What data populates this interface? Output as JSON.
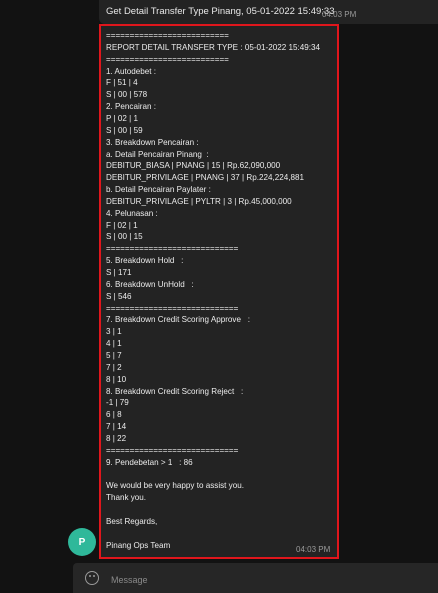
{
  "header_message": {
    "text": "Get Detail Transfer Type Pinang, 05-01-2022 15:49:33",
    "time": "04:03 PM"
  },
  "message": {
    "lines": [
      "==========================",
      "REPORT DETAIL TRANSFER TYPE : 05-01-2022 15:49:34",
      "==========================",
      "1. Autodebet :",
      "F | 51 | 4",
      "S | 00 | 578",
      "2. Pencairan :",
      "P | 02 | 1",
      "S | 00 | 59",
      "3. Breakdown Pencairan :",
      "a. Detail Pencairan Pinang  :",
      "DEBITUR_BIASA | PNANG | 15 | Rp.62,090,000",
      "DEBITUR_PRIVILAGE | PNANG | 37 | Rp.224,224,881",
      "b. Detail Pencairan Paylater :",
      "DEBITUR_PRIVILAGE | PYLTR | 3 | Rp.45,000,000",
      "4. Pelunasan :",
      "F | 02 | 1",
      "S | 00 | 15",
      "============================",
      "5. Breakdown Hold   :",
      "S | 171",
      "6. Breakdown UnHold   :",
      "S | 546",
      "============================",
      "7. Breakdown Credit Scoring Approve   :",
      "3 | 1",
      "4 | 1",
      "5 | 7",
      "7 | 2",
      "8 | 10",
      "8. Breakdown Credit Scoring Reject   :",
      "-1 | 79",
      "6 | 8",
      "7 | 14",
      "8 | 22",
      "============================",
      "9. Pendebetan > 1   : 86",
      "",
      "We would be very happy to assist you.",
      "Thank you.",
      "",
      "Best Regards,",
      "",
      "Pinang Ops Team"
    ],
    "time": "04:03 PM"
  },
  "sender": {
    "avatar_letter": "P",
    "avatar_color": "#2fb89a"
  },
  "composer": {
    "placeholder": "Message"
  },
  "colors": {
    "highlight_border": "#e0161c",
    "bubble_bg": "#232323",
    "app_bg": "#121212"
  }
}
